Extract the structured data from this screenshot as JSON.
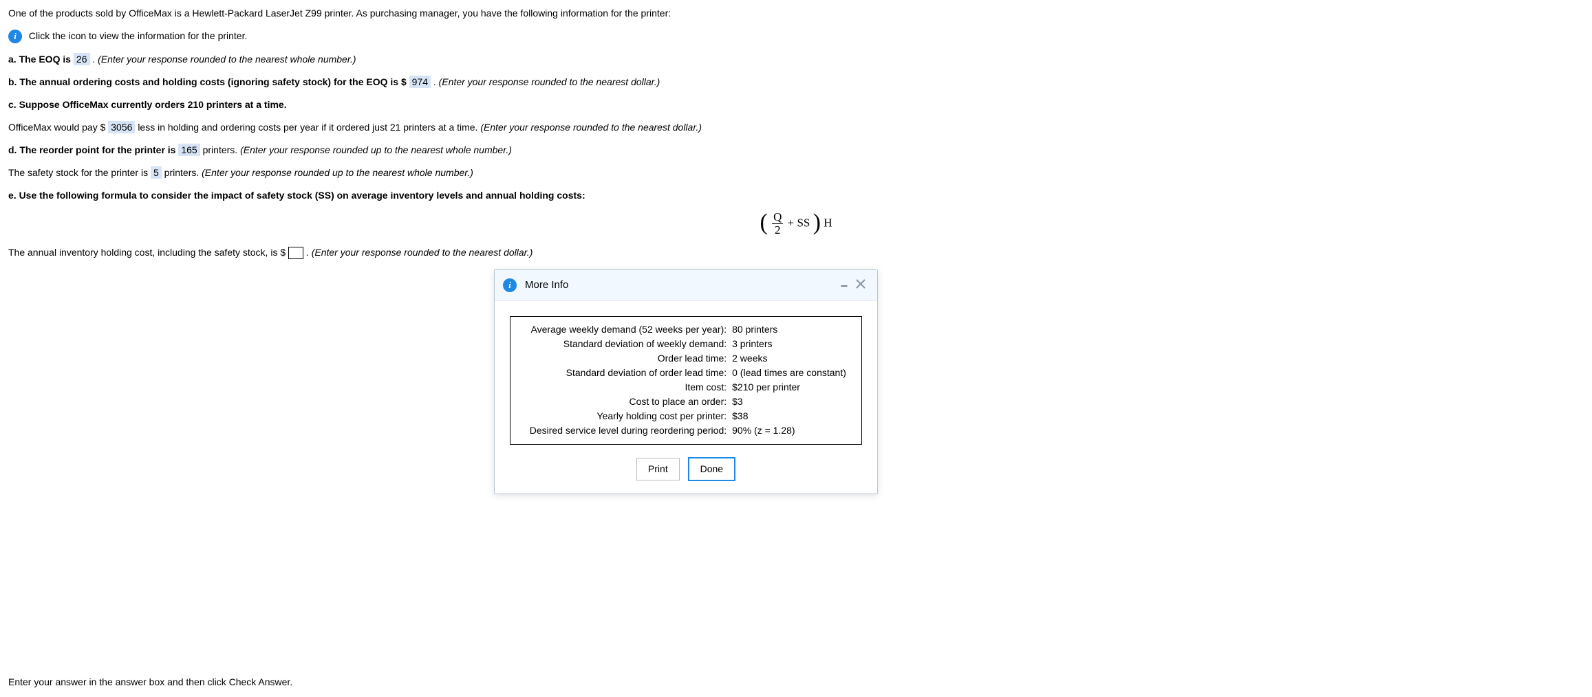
{
  "intro": "One of the products sold by OfficeMax is a Hewlett-Packard LaserJet Z99 printer. As purchasing manager, you have the following information for the printer:",
  "click_icon": "Click the icon to view the information for the printer.",
  "a": {
    "pre": "a. The EOQ is ",
    "val": "26",
    "post": " . ",
    "hint": "(Enter your response rounded to the nearest whole number.)"
  },
  "b": {
    "pre": "b. The annual ordering costs and holding costs (ignoring safety stock) for the EOQ is $ ",
    "val": "974",
    "post": " . ",
    "hint": "(Enter your response rounded to the nearest dollar.)"
  },
  "c": {
    "line1": "c. Suppose OfficeMax currently orders 210 printers at a time.",
    "pre": "OfficeMax would pay $ ",
    "val": "3056",
    "post": "  less in holding and ordering costs per year if it ordered just 21 printers at a time. ",
    "hint": "(Enter your response rounded to the nearest dollar.)"
  },
  "d": {
    "pre": "d. The reorder point for the printer is  ",
    "val": "165",
    "post": "  printers. ",
    "hint": "(Enter your response rounded up to the nearest whole number.)"
  },
  "safety": {
    "pre": "The safety stock for the printer is  ",
    "val": "5",
    "post": "  printers. ",
    "hint": "(Enter your response rounded up to the nearest whole number.)"
  },
  "e": {
    "line": "e. Use the following formula to consider the impact of safety stock (SS) on average inventory levels and annual holding costs:"
  },
  "formula": {
    "num": "Q",
    "den": "2",
    "plus": " + SS",
    "outer": "H"
  },
  "annual": {
    "pre": "The annual inventory holding cost, including the safety stock, is $",
    "post": ". ",
    "hint": "(Enter your response rounded to the nearest dollar.)"
  },
  "modal": {
    "title": "More Info",
    "rows": [
      {
        "label": "Average weekly demand (52 weeks per year):",
        "value": "80 printers"
      },
      {
        "label": "Standard deviation of weekly demand:",
        "value": "3 printers"
      },
      {
        "label": "Order lead time:",
        "value": "2 weeks"
      },
      {
        "label": "Standard deviation of order lead time:",
        "value": "0 (lead times are constant)"
      },
      {
        "label": "Item cost:",
        "value": "$210 per printer"
      },
      {
        "label": "Cost to place an order:",
        "value": "$3"
      },
      {
        "label": "Yearly holding cost per printer:",
        "value": "$38"
      },
      {
        "label": "Desired service level during reordering period:",
        "value": "90% (z = 1.28)"
      }
    ],
    "print": "Print",
    "done": "Done"
  },
  "footer": "Enter your answer in the answer box and then click Check Answer."
}
